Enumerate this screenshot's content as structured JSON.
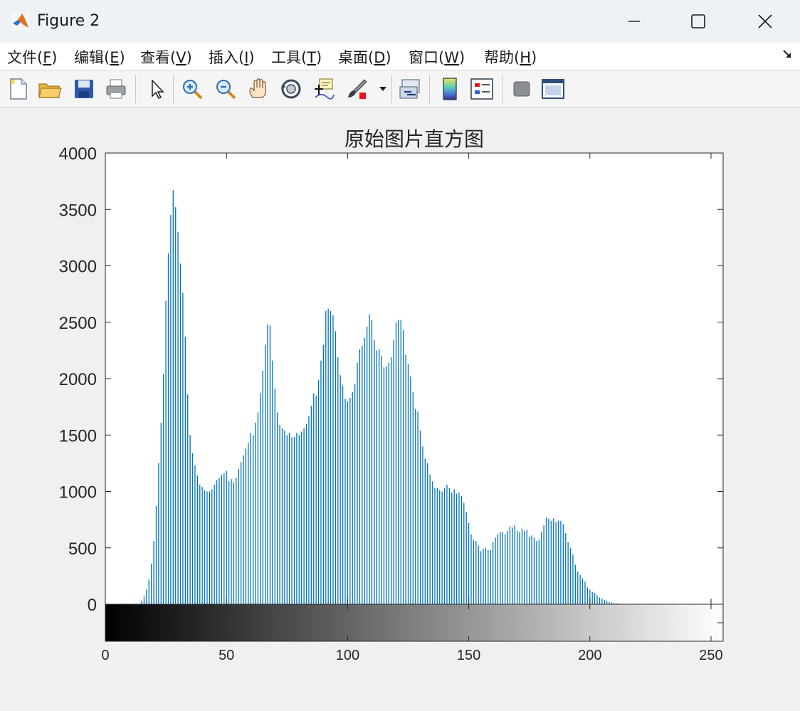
{
  "window": {
    "title": "Figure 2"
  },
  "menu": [
    {
      "label": "文件(",
      "mnemonic": "F",
      "close": ")"
    },
    {
      "label": "编辑(",
      "mnemonic": "E",
      "close": ")"
    },
    {
      "label": "查看(",
      "mnemonic": "V",
      "close": ")"
    },
    {
      "label": "插入(",
      "mnemonic": "I",
      "close": ")"
    },
    {
      "label": "工具(",
      "mnemonic": "T",
      "close": ")"
    },
    {
      "label": "桌面(",
      "mnemonic": "D",
      "close": ")"
    },
    {
      "label": "窗口(",
      "mnemonic": "W",
      "close": ")"
    },
    {
      "label": "帮助(",
      "mnemonic": "H",
      "close": ")"
    }
  ],
  "toolbar_icons": [
    "new-figure-icon",
    "open-folder-icon",
    "save-icon",
    "print-icon",
    "pointer-icon",
    "zoom-in-icon",
    "zoom-out-icon",
    "pan-hand-icon",
    "rotate-3d-icon",
    "data-cursor-icon",
    "brush-icon",
    "brush-dropdown-icon",
    "link-plot-icon",
    "colorbar-icon",
    "legend-icon",
    "hide-tools-icon",
    "dock-figure-icon"
  ],
  "colors": {
    "bar": "#0072bd",
    "axes": "#262626"
  },
  "chart_data": {
    "type": "bar",
    "title": "原始图片直方图",
    "xlabel": "",
    "ylabel": "",
    "x": [
      0,
      1,
      2,
      3,
      4,
      5,
      6,
      7,
      8,
      9,
      10,
      11,
      12,
      13,
      14,
      15,
      16,
      17,
      18,
      19,
      20,
      21,
      22,
      23,
      24,
      25,
      26,
      27,
      28,
      29,
      30,
      31,
      32,
      33,
      34,
      35,
      36,
      37,
      38,
      39,
      40,
      41,
      42,
      43,
      44,
      45,
      46,
      47,
      48,
      49,
      50,
      51,
      52,
      53,
      54,
      55,
      56,
      57,
      58,
      59,
      60,
      61,
      62,
      63,
      64,
      65,
      66,
      67,
      68,
      69,
      70,
      71,
      72,
      73,
      74,
      75,
      76,
      77,
      78,
      79,
      80,
      81,
      82,
      83,
      84,
      85,
      86,
      87,
      88,
      89,
      90,
      91,
      92,
      93,
      94,
      95,
      96,
      97,
      98,
      99,
      100,
      101,
      102,
      103,
      104,
      105,
      106,
      107,
      108,
      109,
      110,
      111,
      112,
      113,
      114,
      115,
      116,
      117,
      118,
      119,
      120,
      121,
      122,
      123,
      124,
      125,
      126,
      127,
      128,
      129,
      130,
      131,
      132,
      133,
      134,
      135,
      136,
      137,
      138,
      139,
      140,
      141,
      142,
      143,
      144,
      145,
      146,
      147,
      148,
      149,
      150,
      151,
      152,
      153,
      154,
      155,
      156,
      157,
      158,
      159,
      160,
      161,
      162,
      163,
      164,
      165,
      166,
      167,
      168,
      169,
      170,
      171,
      172,
      173,
      174,
      175,
      176,
      177,
      178,
      179,
      180,
      181,
      182,
      183,
      184,
      185,
      186,
      187,
      188,
      189,
      190,
      191,
      192,
      193,
      194,
      195,
      196,
      197,
      198,
      199,
      200,
      201,
      202,
      203,
      204,
      205,
      206,
      207,
      208,
      209,
      210,
      211,
      212,
      213,
      214,
      215,
      216,
      217,
      218,
      219,
      220,
      221,
      222,
      223,
      224,
      225,
      226,
      227,
      228,
      229,
      230,
      231,
      232,
      233,
      234,
      235,
      236,
      237,
      238,
      239,
      240,
      241,
      242,
      243,
      244,
      245,
      246,
      247,
      248,
      249,
      250,
      251,
      252,
      253,
      254,
      255
    ],
    "values": [
      0,
      0,
      0,
      0,
      0,
      0,
      0,
      0,
      0,
      0,
      0,
      0,
      0,
      0,
      5,
      30,
      70,
      130,
      220,
      360,
      560,
      870,
      1250,
      1610,
      2040,
      2690,
      3110,
      3450,
      3670,
      3520,
      3300,
      3020,
      2760,
      2370,
      1860,
      1500,
      1340,
      1230,
      1140,
      1060,
      1040,
      1010,
      1000,
      1000,
      1020,
      1060,
      1100,
      1120,
      1150,
      1160,
      1180,
      1090,
      1110,
      1080,
      1120,
      1200,
      1260,
      1320,
      1380,
      1430,
      1520,
      1500,
      1610,
      1700,
      1870,
      2070,
      2300,
      2480,
      2470,
      2160,
      1910,
      1700,
      1590,
      1560,
      1540,
      1500,
      1520,
      1480,
      1480,
      1520,
      1500,
      1530,
      1560,
      1600,
      1670,
      1760,
      1870,
      1850,
      1990,
      2160,
      2300,
      2600,
      2620,
      2600,
      2560,
      2420,
      2190,
      2030,
      1940,
      1820,
      1800,
      1830,
      1880,
      1950,
      2140,
      2260,
      2290,
      2360,
      2460,
      2570,
      2520,
      2340,
      2250,
      2260,
      2200,
      2100,
      2110,
      2140,
      2190,
      2340,
      2500,
      2520,
      2520,
      2430,
      2210,
      2130,
      2020,
      1880,
      1730,
      1710,
      1540,
      1400,
      1290,
      1250,
      1150,
      1090,
      1030,
      1030,
      1010,
      1000,
      1030,
      1060,
      1030,
      990,
      1020,
      980,
      990,
      960,
      900,
      820,
      720,
      620,
      570,
      560,
      520,
      470,
      490,
      500,
      480,
      480,
      550,
      590,
      620,
      640,
      640,
      620,
      650,
      690,
      680,
      700,
      650,
      640,
      670,
      650,
      660,
      600,
      610,
      590,
      560,
      570,
      640,
      700,
      770,
      760,
      740,
      760,
      730,
      740,
      740,
      710,
      630,
      550,
      500,
      440,
      350,
      290,
      260,
      230,
      200,
      150,
      130,
      110,
      100,
      80,
      60,
      50,
      40,
      30,
      20,
      15,
      10,
      8,
      5,
      3,
      2,
      1,
      0,
      0,
      0,
      0,
      0,
      0,
      0,
      0,
      0,
      0,
      0,
      0,
      0,
      0,
      0,
      0,
      0,
      0,
      0,
      0,
      0,
      0,
      0,
      0,
      0,
      0,
      0,
      0,
      0,
      0,
      0,
      0
    ],
    "xlim": [
      0,
      255
    ],
    "ylim": [
      0,
      4000
    ],
    "yticks": [
      "0",
      "500",
      "1000",
      "1500",
      "2000",
      "2500",
      "3000",
      "3500",
      "4000"
    ],
    "xticks": [
      "0",
      "50",
      "100",
      "150",
      "200",
      "250"
    ],
    "colorbar": "grayscale 0-255",
    "grid": false
  }
}
